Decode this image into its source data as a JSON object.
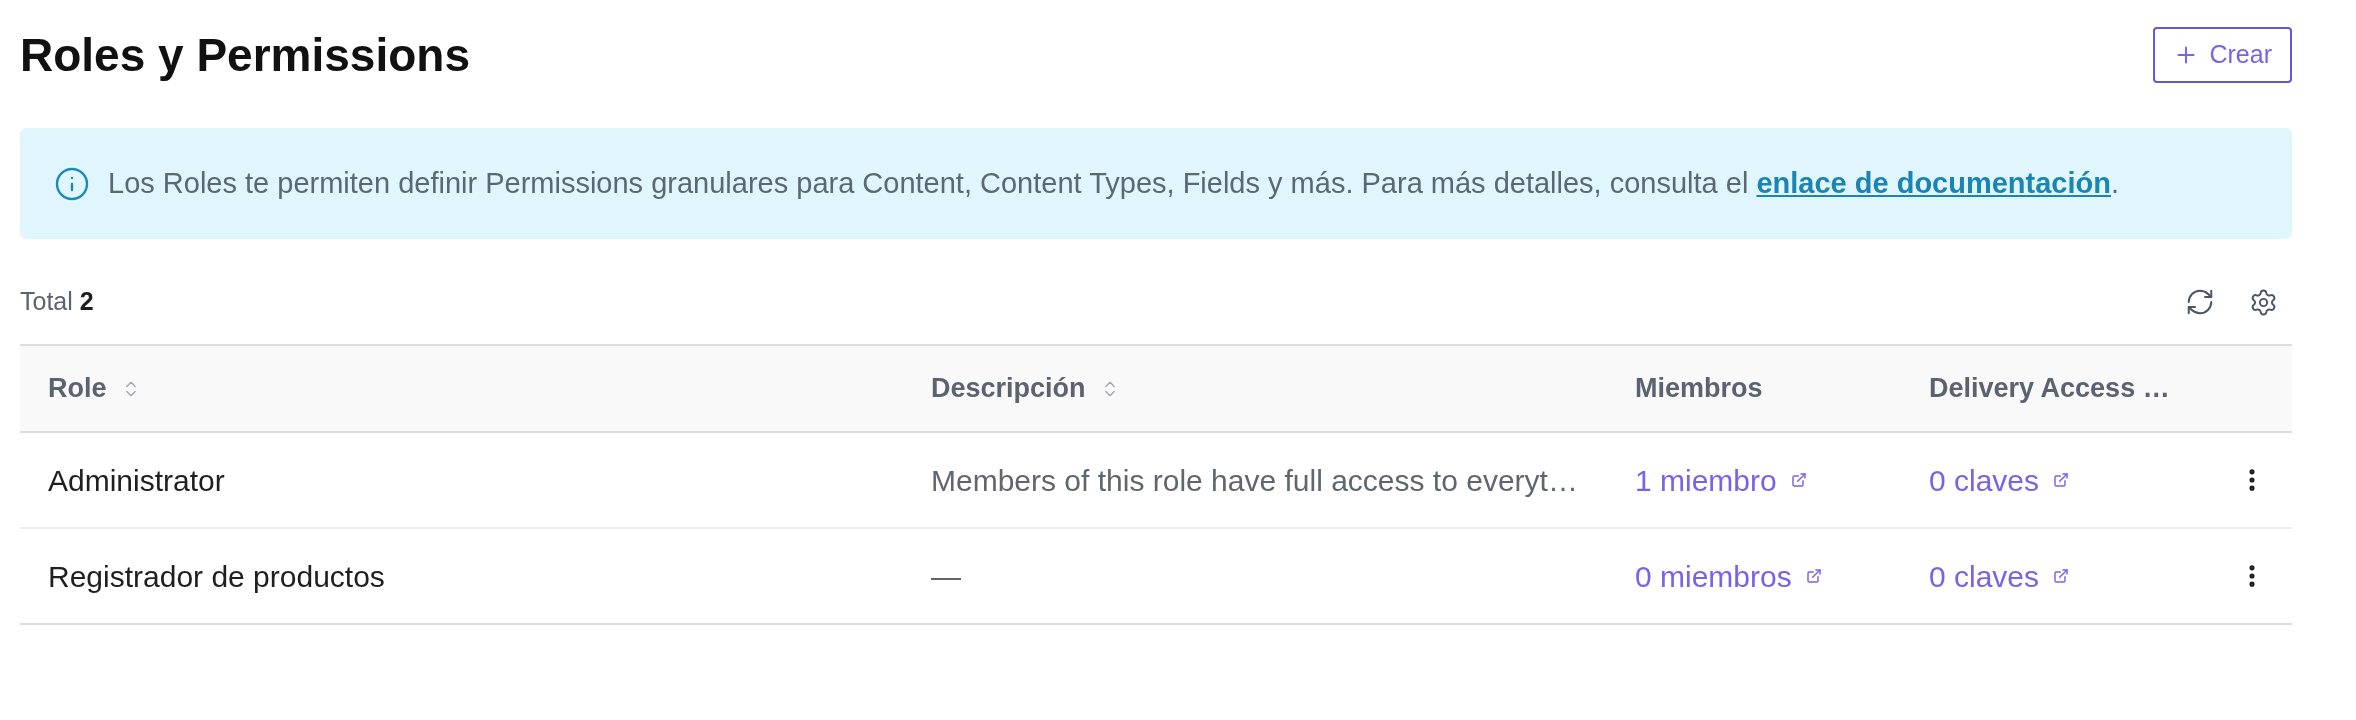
{
  "page_title": "Roles y Permissions",
  "create_button": {
    "label": "Crear"
  },
  "info_banner": {
    "text": "Los Roles te permiten definir Permissions granulares para Content, Content Types, Fields y más. Para más detalles, consulta el",
    "link": "enlace de documentación",
    "after_link": "."
  },
  "summary": {
    "label": "Total",
    "count": "2"
  },
  "table": {
    "columns": [
      {
        "label": "Role",
        "sortable": true
      },
      {
        "label": "Descripción",
        "sortable": true
      },
      {
        "label": "Miembros",
        "sortable": false
      },
      {
        "label": "Delivery Access …",
        "sortable": false
      }
    ],
    "rows": [
      {
        "cells": [
          {
            "kind": "text",
            "text": "Administrator"
          },
          {
            "kind": "muted",
            "text": "Members of this role have full access to everyt…"
          },
          {
            "kind": "link",
            "text": "1 miembro"
          },
          {
            "kind": "link",
            "text": "0 claves"
          }
        ]
      },
      {
        "cells": [
          {
            "kind": "text",
            "text": "Registrador de productos"
          },
          {
            "kind": "muted",
            "text": "—"
          },
          {
            "kind": "link",
            "text": "0 miembros"
          },
          {
            "kind": "link",
            "text": "0 claves"
          }
        ]
      }
    ]
  }
}
